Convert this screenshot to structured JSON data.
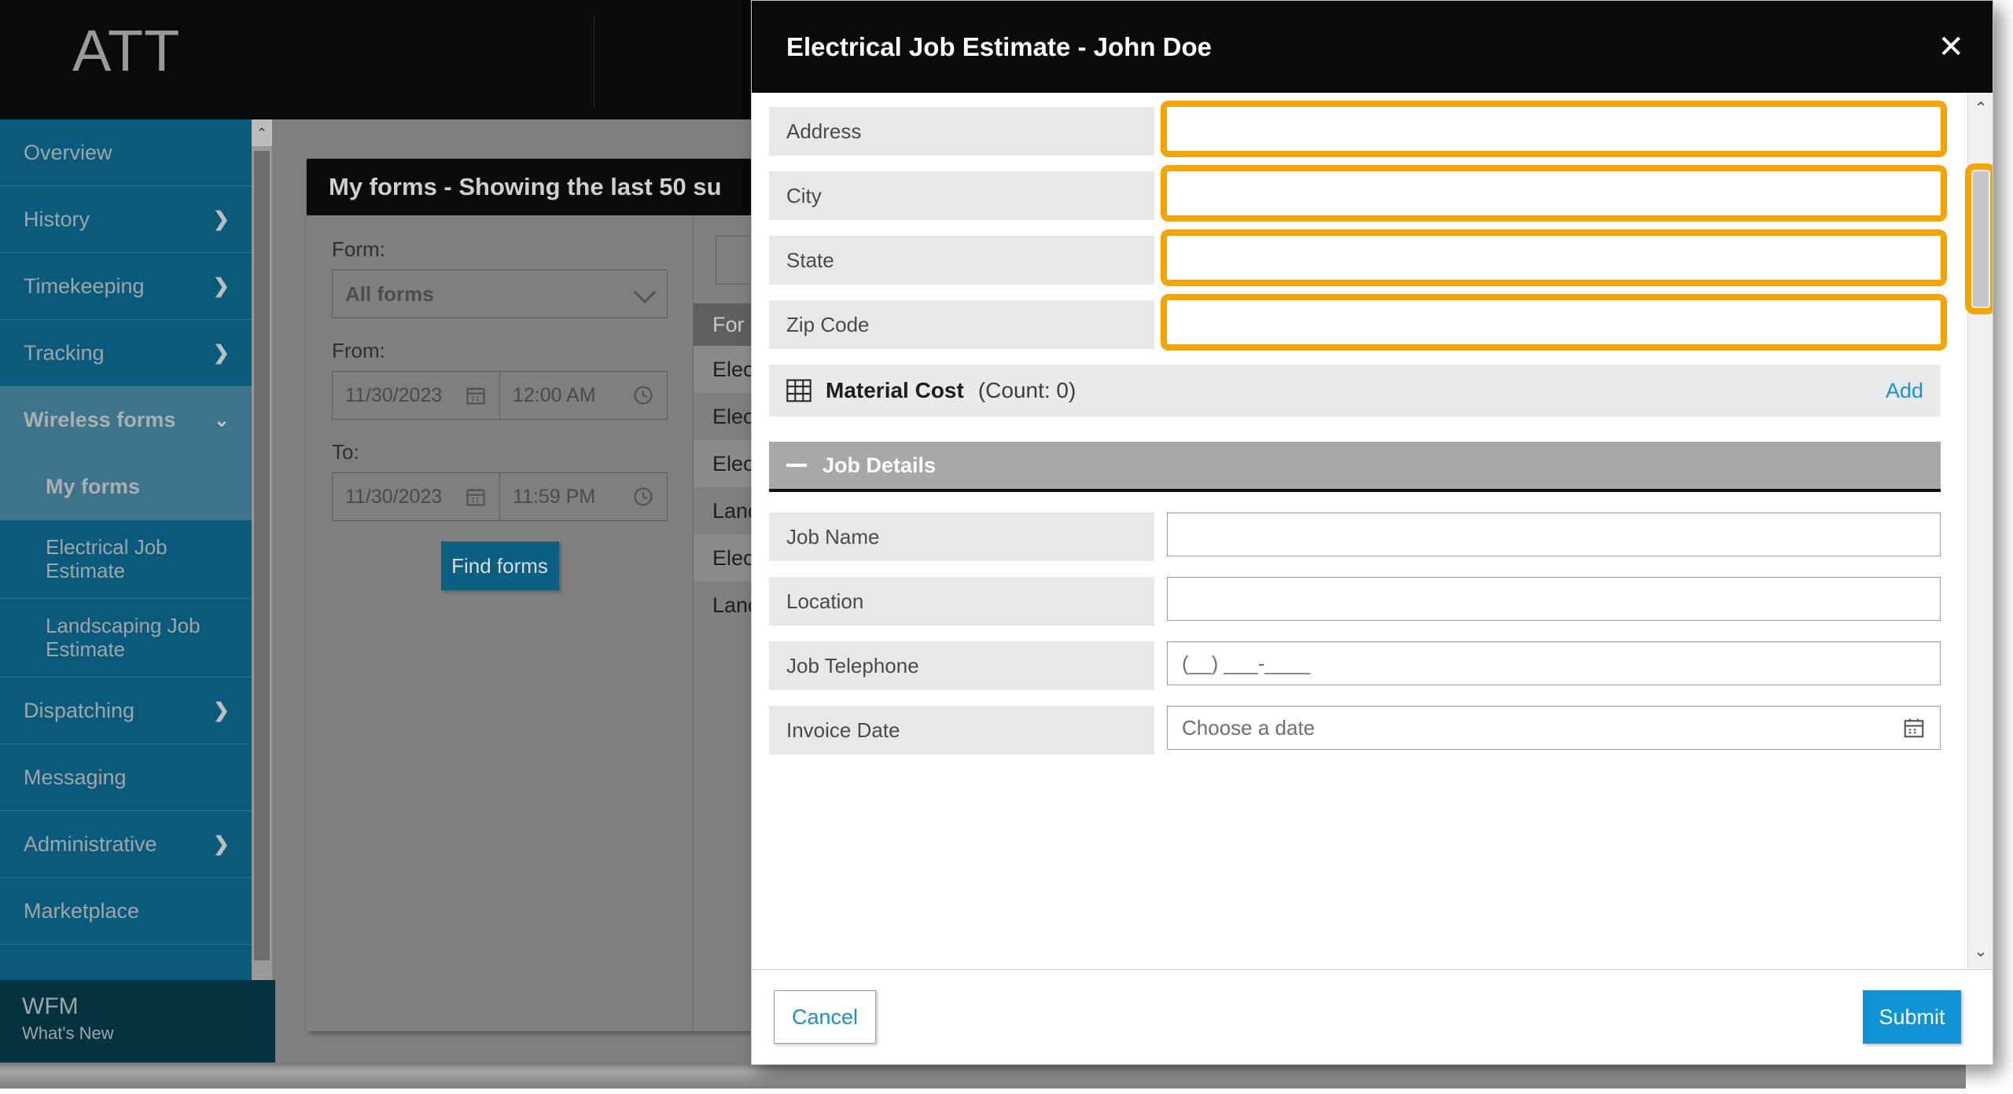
{
  "brand": {
    "logo_text": "ATT"
  },
  "sidebar": {
    "items": [
      {
        "label": "Overview",
        "chevron": ""
      },
      {
        "label": "History",
        "chevron": "❯"
      },
      {
        "label": "Timekeeping",
        "chevron": "❯"
      },
      {
        "label": "Tracking",
        "chevron": "❯"
      }
    ],
    "group": {
      "label": "Wireless forms",
      "chevron": "⌄",
      "active_child": "My forms",
      "children": [
        {
          "label": "Electrical Job Estimate"
        },
        {
          "label": "Landscaping Job Estimate"
        }
      ]
    },
    "items_after": [
      {
        "label": "Dispatching",
        "chevron": "❯"
      },
      {
        "label": "Messaging",
        "chevron": ""
      },
      {
        "label": "Administrative",
        "chevron": "❯"
      },
      {
        "label": "Marketplace",
        "chevron": ""
      }
    ],
    "footer": {
      "title": "WFM",
      "subtitle": "What's New"
    },
    "scroll_up_icon": "⌃",
    "scroll_down_icon": "⌄"
  },
  "panel": {
    "title": "My forms - Showing the last 50 su",
    "filters": {
      "form_label": "Form:",
      "form_value": "All forms",
      "from_label": "From:",
      "from_date": "11/30/2023",
      "from_time": "12:00 AM",
      "to_label": "To:",
      "to_date": "11/30/2023",
      "to_time": "11:59 PM",
      "find_button": "Find forms"
    },
    "table": {
      "search_placeholder": "",
      "columns": [
        "For"
      ],
      "rows": [
        "Elec",
        "Elec",
        "Elec",
        "Land",
        "Elec",
        "Land"
      ]
    }
  },
  "modal": {
    "title": "Electrical Job Estimate - John Doe",
    "close_icon": "✕",
    "fields_highlighted": [
      {
        "label": "Address",
        "value": "",
        "placeholder": ""
      },
      {
        "label": "City",
        "value": "",
        "placeholder": ""
      },
      {
        "label": "State",
        "value": "",
        "placeholder": ""
      },
      {
        "label": "Zip Code",
        "value": "",
        "placeholder": ""
      }
    ],
    "material_cost": {
      "icon": "grid-icon",
      "title": "Material Cost",
      "count_text": "(Count: 0)",
      "add_label": "Add"
    },
    "job_details": {
      "collapse_icon": "minus-icon",
      "title": "Job Details",
      "fields": [
        {
          "label": "Job Name",
          "value": "",
          "placeholder": ""
        },
        {
          "label": "Location",
          "value": "",
          "placeholder": ""
        },
        {
          "label": "Job Telephone",
          "value": "(__) ___-____",
          "placeholder": ""
        },
        {
          "label": "Invoice Date",
          "value": "",
          "placeholder": "Choose a date"
        }
      ]
    },
    "footer": {
      "cancel_label": "Cancel",
      "submit_label": "Submit"
    },
    "scroll_up_icon": "⌃",
    "scroll_down_icon": "⌄"
  },
  "colors": {
    "highlight": "#f5a400",
    "sidebar": "#0a5a7c",
    "accent": "#0f93d4",
    "link": "#1b8fd6"
  }
}
